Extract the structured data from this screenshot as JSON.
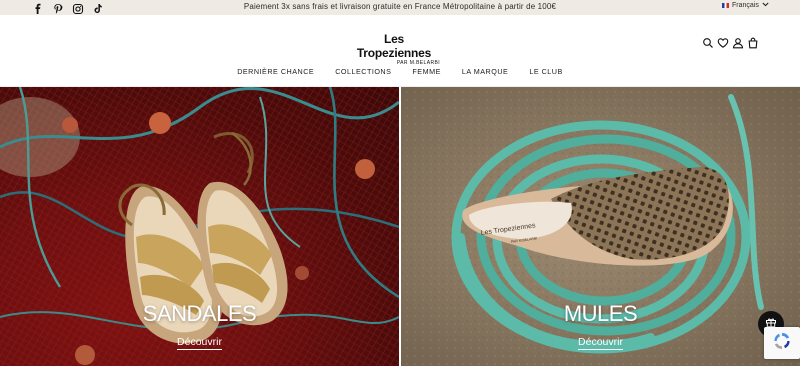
{
  "topbar": {
    "announcement": "Paiement 3x sans frais et livraison gratuite en France Métropolitaine à partir de 100€",
    "language": "Français",
    "social": [
      "facebook-icon",
      "pinterest-icon",
      "instagram-icon",
      "tiktok-icon"
    ]
  },
  "header": {
    "logo": "Les Tropeziennes",
    "logo_sub": "PAR M.BELARBI",
    "icons": [
      "search-icon",
      "heart-icon",
      "user-icon",
      "bag-icon"
    ]
  },
  "nav": {
    "items": [
      "DERNIÈRE CHANCE",
      "COLLECTIONS",
      "FEMME",
      "LA MARQUE",
      "LE CLUB"
    ]
  },
  "hero": {
    "left": {
      "title": "SANDALES",
      "link": "Découvrir"
    },
    "right": {
      "title": "MULES",
      "link": "Découvrir"
    }
  },
  "shoe_brand": "Les Tropeziennes",
  "shoe_sub": "PAR M.BELARBI",
  "colors": {
    "topbar_bg": "#efebe4",
    "text": "#1d1d1d",
    "net_red": "#8a1515",
    "rope_teal": "#5bbca8"
  }
}
